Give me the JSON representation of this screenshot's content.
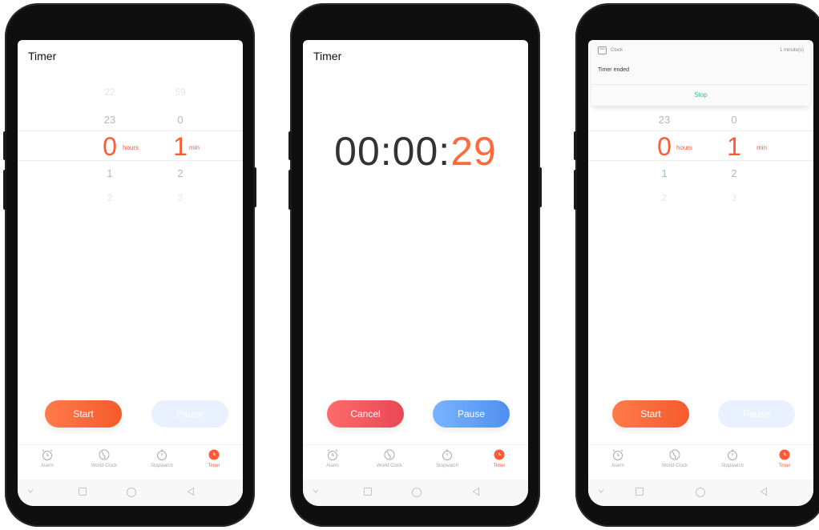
{
  "colors": {
    "accent": "#ff5a36",
    "blue": "#4f8fef",
    "cancel": "#e84855",
    "stop": "#3cc08a"
  },
  "screen1": {
    "title": "Timer",
    "hours_col": [
      "22",
      "23",
      "0",
      "1",
      "2"
    ],
    "min_col": [
      "59",
      "0",
      "1",
      "2",
      "3"
    ],
    "hours_unit": "hours",
    "min_unit": "min",
    "start_label": "Start",
    "pause_label": "Pause"
  },
  "screen2": {
    "title": "Timer",
    "countdown_main": "00:00:",
    "countdown_sec": "29",
    "cancel_label": "Cancel",
    "pause_label": "Pause"
  },
  "screen3": {
    "notification": {
      "app": "Clock",
      "time": "1 minute(s)",
      "message": "Timer ended",
      "stop_label": "Stop"
    },
    "hours_col": [
      "23",
      "0",
      "1",
      "2"
    ],
    "min_col": [
      "0",
      "1",
      "2",
      "3"
    ],
    "hours_unit": "hours",
    "min_unit": "min",
    "start_label": "Start",
    "pause_label": "Pause"
  },
  "tabs": [
    {
      "label": "Alarm",
      "icon": "alarm-icon"
    },
    {
      "label": "World Clock",
      "icon": "globe-icon"
    },
    {
      "label": "Stopwatch",
      "icon": "stopwatch-icon"
    },
    {
      "label": "Timer",
      "icon": "timer-icon"
    }
  ]
}
